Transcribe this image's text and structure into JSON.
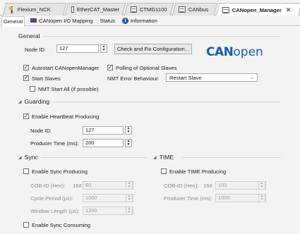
{
  "tabs": [
    {
      "label": "Flexium_NCK"
    },
    {
      "label": "EtherCAT_Master"
    },
    {
      "label": "CTMG1100"
    },
    {
      "label": "CANbus"
    },
    {
      "label": "CANopen_Manager"
    }
  ],
  "subtabs": [
    {
      "label": "General"
    },
    {
      "label": "CANopen I/O Mapping"
    },
    {
      "label": "Status"
    },
    {
      "label": "Information"
    }
  ],
  "general": {
    "title": "General",
    "node_id_label": "Node ID:",
    "node_id_value": "127",
    "check_button": "Check and Fix Configuration...",
    "logo_bold": "CAN",
    "logo_light": "open",
    "autostart_label": "Autostart CANopenManager",
    "autostart_checked": true,
    "polling_label": "Polling of Optional Slaves",
    "polling_checked": true,
    "start_slaves_label": "Start Slaves",
    "start_slaves_checked": true,
    "nmt_error_label": "NMT Error Behaviour:",
    "nmt_error_value": "Restart Slave",
    "nmt_start_all_label": "NMT Start All (if possible)",
    "nmt_start_all_checked": false
  },
  "guarding": {
    "title": "Guarding",
    "heartbeat_label": "Enable Heartbeat Producing",
    "heartbeat_checked": true,
    "node_id_label": "Node ID:",
    "node_id_value": "127",
    "producer_time_label": "Producer Time (ms):",
    "producer_time_value": "200"
  },
  "sync": {
    "title": "Sync",
    "enable_label": "Enable Sync Producing",
    "enable_checked": false,
    "cobid_label": "COB-ID (Hex):",
    "cobid_prefix": "16#",
    "cobid_value": "80",
    "cycle_label": "Cycle Period (µs):",
    "cycle_value": "1000",
    "window_label": "Window Length (µs):",
    "window_value": "1200",
    "consume_label": "Enable Sync Consuming",
    "consume_checked": false
  },
  "time": {
    "title": "TIME",
    "enable_label": "Enable TIME Producing",
    "enable_checked": false,
    "cobid_label": "COB-ID (Hex):",
    "cobid_prefix": "16#",
    "cobid_value": "100",
    "producer_label": "Producer Time (ms):",
    "producer_value": "1000"
  },
  "colors": {
    "accent": "#1f5aa8",
    "background": "#f3f3f3"
  }
}
